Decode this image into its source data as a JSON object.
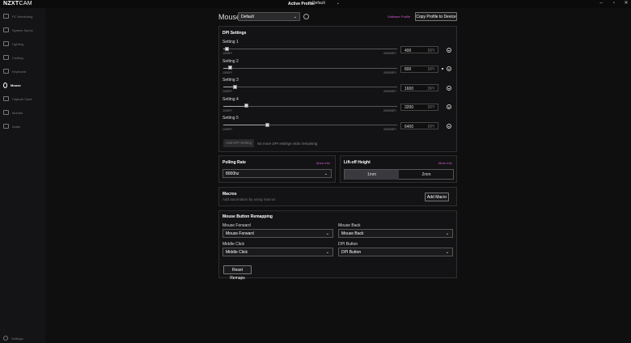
{
  "app": {
    "logo_main": "NZXT",
    "logo_sub": "CAM"
  },
  "titlebar": {
    "active_profile_label": "Active Profile:",
    "active_profile_value": "Default"
  },
  "sidebar": {
    "items": [
      {
        "label": "PC Monitoring"
      },
      {
        "label": "System Specs"
      },
      {
        "label": "Lighting"
      },
      {
        "label": "Cooling"
      },
      {
        "label": "Keyboard"
      },
      {
        "label": "Mouse"
      },
      {
        "label": "Capture Card"
      },
      {
        "label": "Monitor"
      },
      {
        "label": "Audio"
      }
    ],
    "settings_label": "Settings"
  },
  "header": {
    "title": "Mouse",
    "device_select": "Default",
    "software_profile": "Software Profile",
    "copy_button": "Copy Profile to Device"
  },
  "dpi": {
    "title": "DPI Settings",
    "min_label": "100DPI",
    "max_label": "26000DPI",
    "unit": "DPI",
    "range": [
      100,
      26000
    ],
    "settings": [
      {
        "label": "Setting 1",
        "value": "400"
      },
      {
        "label": "Setting 2",
        "value": "800"
      },
      {
        "label": "Setting 3",
        "value": "1600"
      },
      {
        "label": "Setting 4",
        "value": "3200"
      },
      {
        "label": "Setting 5",
        "value": "6400"
      }
    ],
    "add_button": "Add DPI Setting",
    "no_slots": "No more DPI settings slots remaining"
  },
  "polling": {
    "title": "Polling Rate",
    "more_info": "More Info",
    "value": "8000hz"
  },
  "liftoff": {
    "title": "Lift-off Height",
    "more_info": "More Info",
    "options": [
      "1mm",
      "2mm"
    ],
    "selected": "1mm"
  },
  "macros": {
    "title": "Macros",
    "description": "Add automation by using macros",
    "add_button": "Add Macro"
  },
  "remapping": {
    "title": "Mouse Button Remapping",
    "fields": [
      {
        "label": "Mouse Forward",
        "value": "Mouse Forward"
      },
      {
        "label": "Mouse Back",
        "value": "Mouse Back"
      },
      {
        "label": "Middle Click",
        "value": "Middle Click"
      },
      {
        "label": "DPI Button",
        "value": "DPI Button"
      }
    ],
    "reset_button": "Reset Remaps"
  },
  "colors": {
    "accent": "#d45cd4",
    "background": "#0f0f10",
    "sidebar": "#141416"
  }
}
